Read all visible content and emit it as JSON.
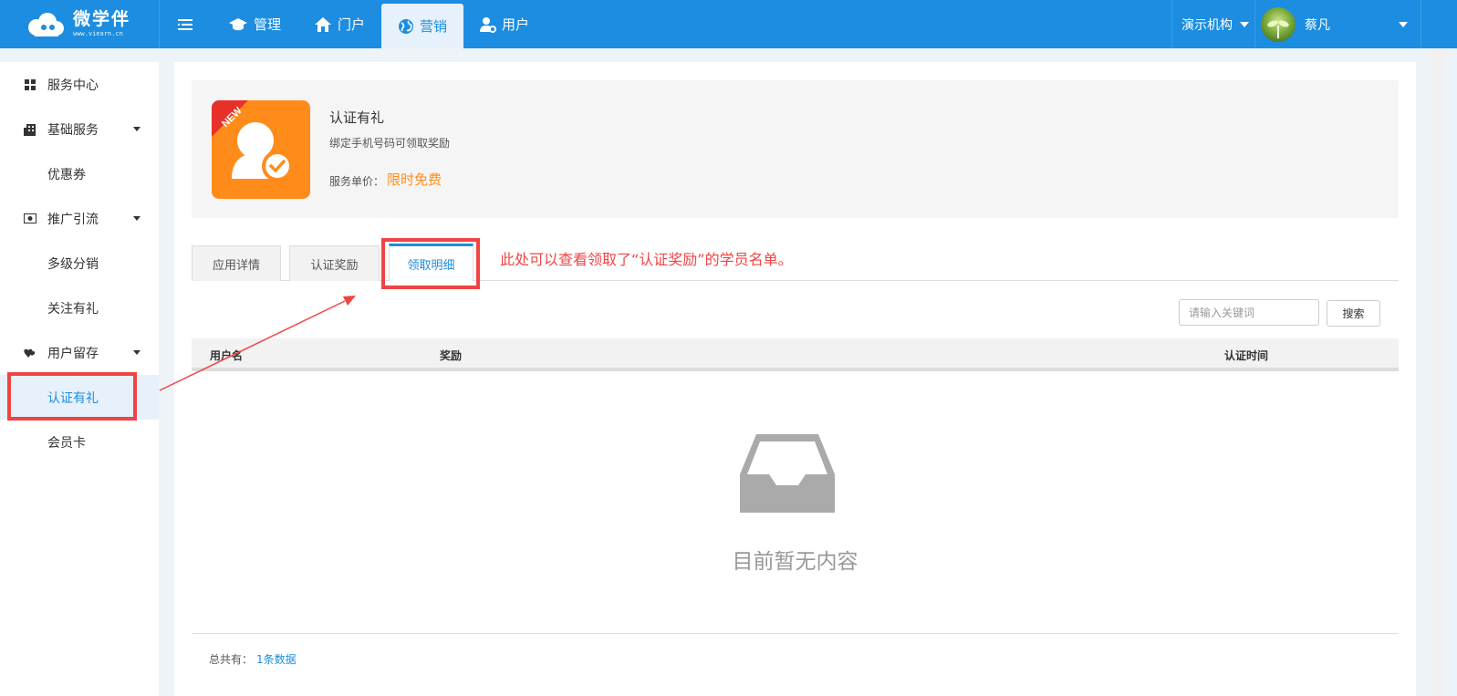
{
  "brand": {
    "name": "微学伴",
    "site": "www.viearn.cn"
  },
  "topnav": {
    "items": [
      {
        "label": "管理",
        "icon": "graduation-cap-icon"
      },
      {
        "label": "门户",
        "icon": "home-icon"
      },
      {
        "label": "营销",
        "icon": "globe-icon"
      },
      {
        "label": "用户",
        "icon": "user-gear-icon"
      }
    ],
    "active": "营销",
    "org": "演示机构",
    "username": "蔡凡"
  },
  "sidebar": {
    "items": [
      {
        "label": "服务中心",
        "icon": "grid-icon"
      },
      {
        "label": "基础服务",
        "icon": "building-icon"
      },
      {
        "label": "优惠券"
      },
      {
        "label": "推广引流",
        "icon": "money-icon"
      },
      {
        "label": "多级分销"
      },
      {
        "label": "关注有礼"
      },
      {
        "label": "用户留存",
        "icon": "hearts-icon"
      },
      {
        "label": "认证有礼"
      },
      {
        "label": "会员卡"
      }
    ],
    "active": "认证有礼"
  },
  "app": {
    "title": "认证有礼",
    "description": "绑定手机号码可领取奖励",
    "price_label": "服务单价：",
    "price": "限时免费",
    "badge": "NEW"
  },
  "tabs": [
    "应用详情",
    "认证奖励",
    "领取明细"
  ],
  "active_tab": "领取明细",
  "annotation": "此处可以查看领取了“认证奖励”的学员名单。",
  "search": {
    "placeholder": "请输入关键词",
    "button": "搜索"
  },
  "table": {
    "columns": [
      "用户名",
      "奖励",
      "认证时间"
    ],
    "rows": []
  },
  "empty_text": "目前暂无内容",
  "footer": {
    "label": "总共有：",
    "count": "1条数据"
  },
  "colors": {
    "primary": "#1c8de0",
    "accent": "#ff8c1a",
    "annotation": "#f04444"
  }
}
